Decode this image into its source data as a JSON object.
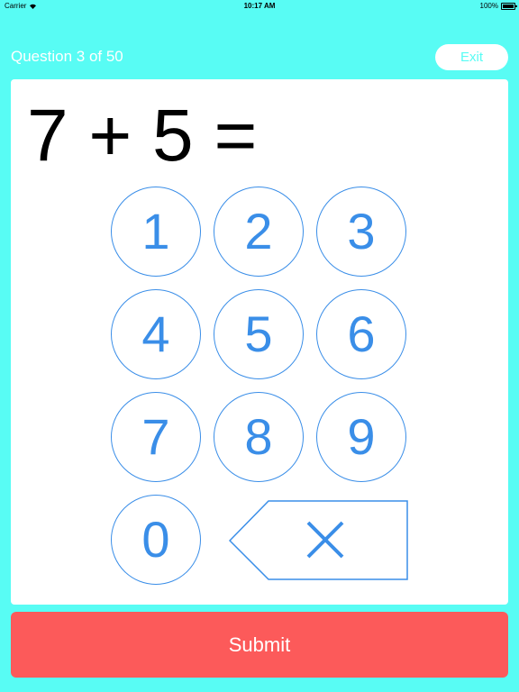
{
  "status_bar": {
    "carrier": "Carrier",
    "time": "10:17 AM",
    "battery": "100%"
  },
  "header": {
    "question_label": "Question 3 of 50",
    "exit_label": "Exit"
  },
  "equation": "7 + 5 =",
  "keypad": {
    "keys": [
      "1",
      "2",
      "3",
      "4",
      "5",
      "6",
      "7",
      "8",
      "9",
      "0"
    ],
    "delete_icon": "backspace-icon"
  },
  "submit_label": "Submit",
  "colors": {
    "background": "#58fcf4",
    "accent": "#3a8ee8",
    "submit": "#fc5a5a"
  }
}
